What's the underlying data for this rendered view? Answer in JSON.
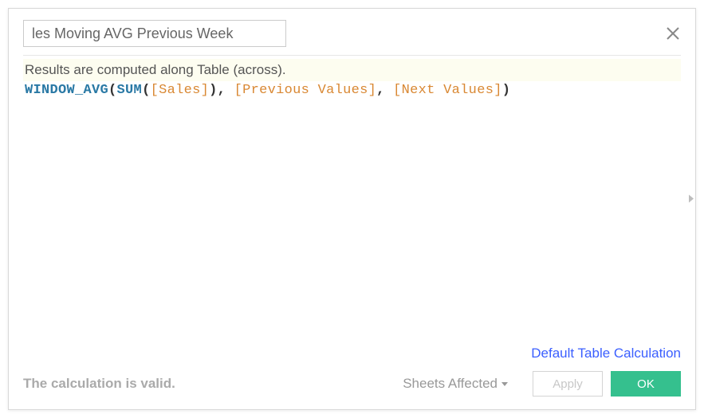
{
  "header": {
    "title_value": "les Moving AVG Previous Week",
    "close_icon": "close-icon"
  },
  "content": {
    "status_line": "Results are computed along Table (across).",
    "formula_tokens": {
      "t0": "WINDOW_AVG",
      "t1": "(",
      "t2": "SUM",
      "t3": "(",
      "t4": "[Sales]",
      "t5": ")",
      "t6": ", ",
      "t7": "[Previous Values]",
      "t8": ", ",
      "t9": "[Next Values]",
      "t10": ")"
    }
  },
  "footer": {
    "link_label": "Default Table Calculation",
    "status_text": "The calculation is valid.",
    "sheets_label": "Sheets Affected",
    "apply_label": "Apply",
    "ok_label": "OK"
  }
}
